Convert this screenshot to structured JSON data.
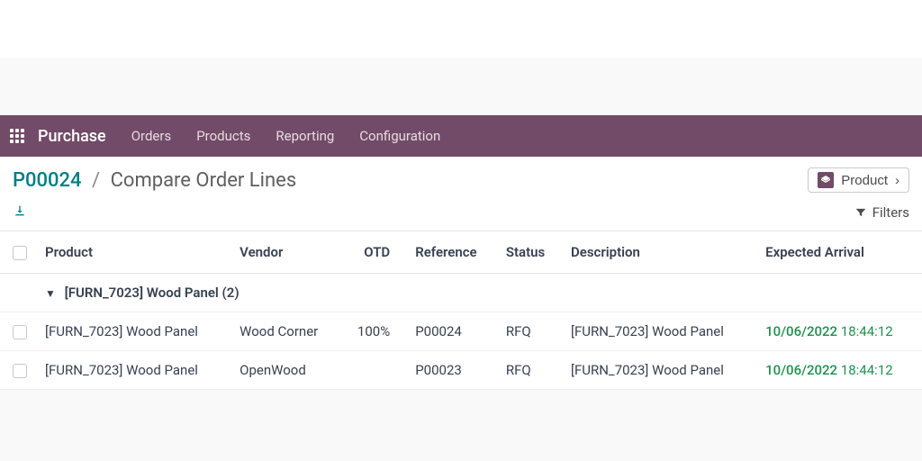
{
  "topbar": {
    "app_name": "Purchase",
    "menu": [
      "Orders",
      "Products",
      "Reporting",
      "Configuration"
    ]
  },
  "breadcrumb": {
    "link": "P00024",
    "current": "Compare Order Lines"
  },
  "view_button": {
    "label": "Product"
  },
  "filters_label": "Filters",
  "columns": {
    "product": "Product",
    "vendor": "Vendor",
    "otd": "OTD",
    "reference": "Reference",
    "status": "Status",
    "description": "Description",
    "expected": "Expected Arrival"
  },
  "group": {
    "label": "[FURN_7023] Wood Panel (2)"
  },
  "rows": [
    {
      "product": "[FURN_7023] Wood Panel",
      "vendor": "Wood Corner",
      "otd": "100%",
      "reference": "P00024",
      "status": "RFQ",
      "description": "[FURN_7023] Wood Panel",
      "expected_date": "10/06/2022",
      "expected_time": "18:44:12"
    },
    {
      "product": "[FURN_7023] Wood Panel",
      "vendor": "OpenWood",
      "otd": "",
      "reference": "P00023",
      "status": "RFQ",
      "description": "[FURN_7023] Wood Panel",
      "expected_date": "10/06/2022",
      "expected_time": "18:44:12"
    }
  ]
}
